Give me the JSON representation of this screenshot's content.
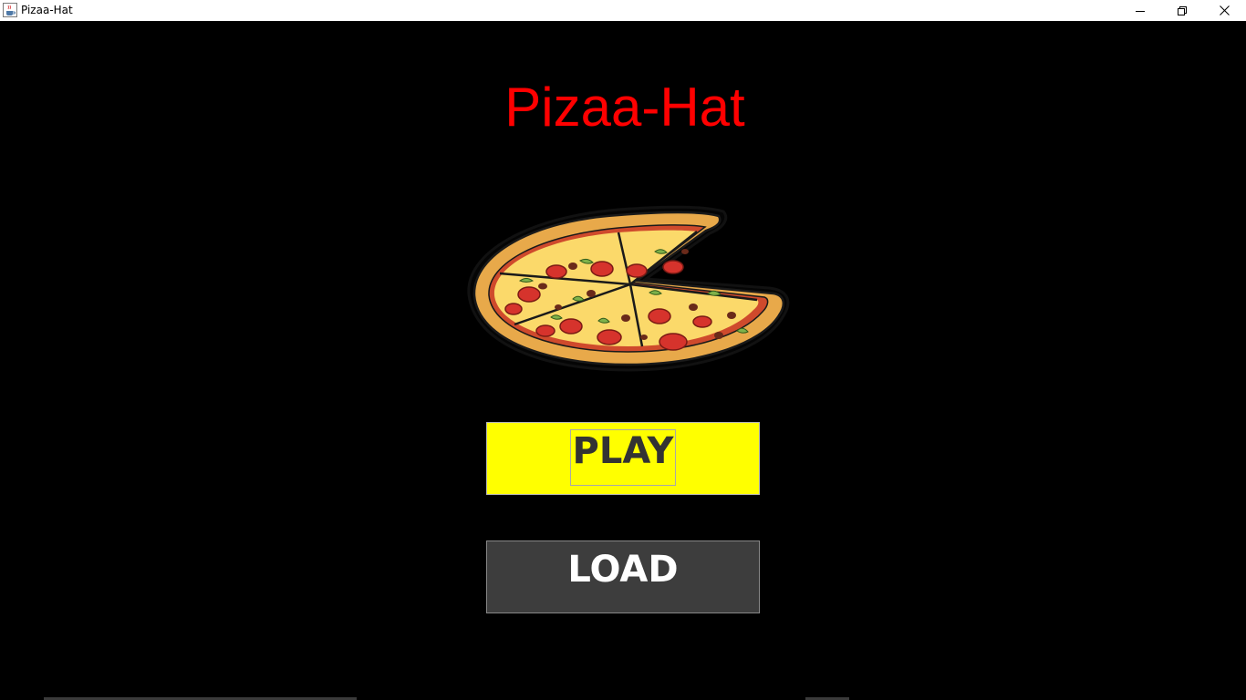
{
  "window": {
    "title": "Pizaa-Hat",
    "app_icon": "java-cup-icon",
    "controls": {
      "minimize_icon": "minimize-icon",
      "maximize_icon": "restore-icon",
      "close_icon": "close-icon"
    }
  },
  "game": {
    "title": "Pizaa-Hat",
    "title_color": "#ff0000",
    "logo_icon": "pizza-icon",
    "buttons": {
      "play_label": "PLAY",
      "play_color": "#ffff00",
      "load_label": "LOAD",
      "load_color": "#3d3d3d"
    }
  }
}
